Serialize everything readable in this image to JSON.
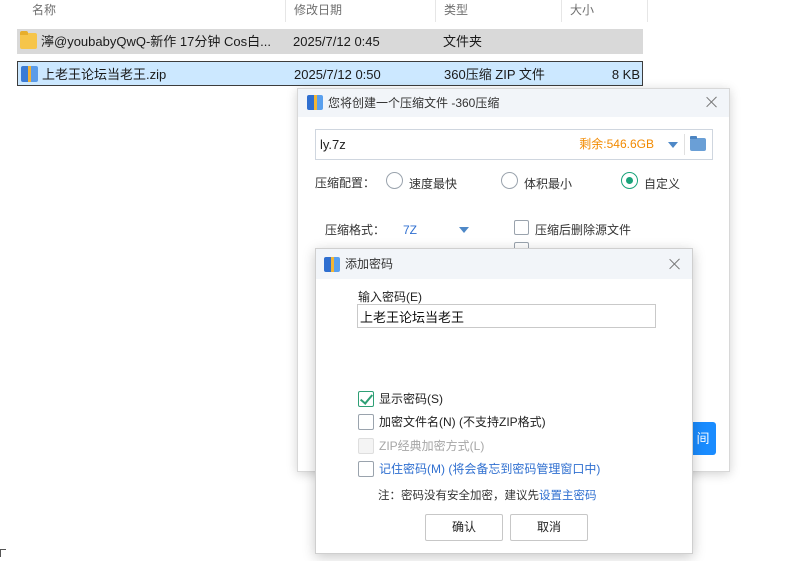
{
  "explorer": {
    "columns": [
      "名称",
      "修改日期",
      "类型",
      "大小"
    ],
    "files": [
      {
        "name": "濘@youbabyQwQ-新作 17分钟 Cos白...",
        "date": "2025/7/12 0:45",
        "type": "文件夹",
        "size": "",
        "icon": "folder-icon"
      },
      {
        "name": "上老王论坛当老王.zip",
        "date": "2025/7/12 0:50",
        "type": "360压缩 ZIP 文件",
        "size": "8 KB",
        "icon": "zip-file-icon"
      }
    ]
  },
  "compress_dialog": {
    "title": "您将创建一个压缩文件 -360压缩",
    "path_value": "ly.7z",
    "free_space": "剩余:546.6GB",
    "config_label": "压缩配置：",
    "options": [
      "速度最快",
      "体积最小",
      "自定义"
    ],
    "selected_option": "自定义",
    "format_label": "压缩格式：",
    "format_value": "7Z",
    "delete_source_label": "压缩后删除源文件",
    "start_button_partial": "间"
  },
  "password_dialog": {
    "title": "添加密码",
    "input_label": "输入密码(E)",
    "password_value": "上老王论坛当老王",
    "show_password": "显示密码(S)",
    "encrypt_names": "加密文件名(N) (不支持ZIP格式)",
    "zip_classic": "ZIP经典加密方式(L)",
    "remember_password": "记住密码(M) (将会备忘到密码管理窗口中)",
    "note_prefix": "注：密码没有安全加密，建议先",
    "note_link": "设置主密码",
    "ok_label": "确认",
    "cancel_label": "取消"
  },
  "colors": {
    "selection": "#cce8ff",
    "accent_blue": "#2f6fd0",
    "free_space": "#f28a00",
    "check_green": "#2e9f75"
  }
}
